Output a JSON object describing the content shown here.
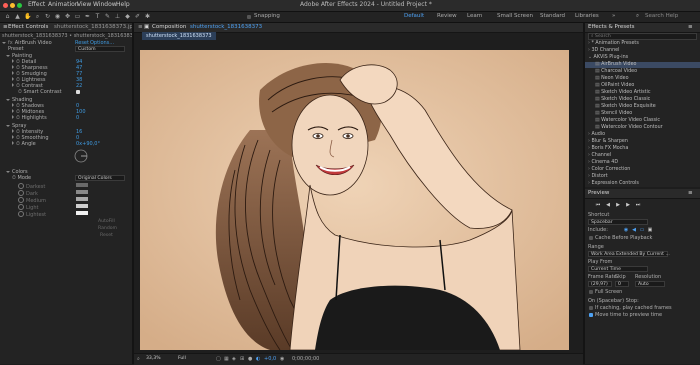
{
  "menubar": {
    "items": [
      "Effect",
      "Animation",
      "View",
      "Window",
      "Help"
    ],
    "title": "Adobe After Effects 2024 - Untitled Project *"
  },
  "toolbar": {
    "snapping_label": "Snapping",
    "workspaces": [
      "Default",
      "Review",
      "Learn",
      "Small Screen",
      "Standard",
      "Libraries"
    ],
    "search_placeholder": "Search Help"
  },
  "effect_controls": {
    "tab": "Effect Controls",
    "tab_file": "shutterstock_1831638373.jpg",
    "crumb": "shutterstock_1831638373 • shutterstock_1831638373.jpg",
    "effect_name": "AirBrush Video",
    "reset": "Reset",
    "options": "Options...",
    "preset_label": "Preset",
    "preset_value": "Custom",
    "painting_label": "Painting",
    "params_painting": [
      {
        "name": "Detail",
        "value": "94"
      },
      {
        "name": "Sharpness",
        "value": "47"
      },
      {
        "name": "Smudging",
        "value": "77"
      },
      {
        "name": "Lightness",
        "value": "38"
      },
      {
        "name": "Contrast",
        "value": "22"
      }
    ],
    "smart_contrast": "Smart Contrast",
    "shading_label": "Shading",
    "params_shading": [
      {
        "name": "Shadows",
        "value": "0"
      },
      {
        "name": "Midtones",
        "value": "100"
      },
      {
        "name": "Highlights",
        "value": "0"
      }
    ],
    "spray_label": "Spray",
    "params_spray": [
      {
        "name": "Intensity",
        "value": "16"
      },
      {
        "name": "Smoothing",
        "value": "0"
      },
      {
        "name": "Angle",
        "value": "0x+90,0°"
      }
    ],
    "colors_label": "Colors",
    "mode_label": "Mode",
    "mode_value": "Original Colors",
    "color_rows": [
      "Darkest",
      "Dark",
      "Medium",
      "Light",
      "Lightest"
    ],
    "autofill": "AutoFill",
    "random": "Random",
    "reset_btn": "Reset"
  },
  "composition": {
    "tab": "Composition",
    "comp_name": "shutterstock_1831638373",
    "sub_tab": "shutterstock_1831638373",
    "zoom": "33,3%",
    "resolution": "Full",
    "exposure": "+0,0",
    "timecode": "0;00;00;00"
  },
  "effects_presets": {
    "title": "Effects & Presets",
    "search_placeholder": "Search",
    "items": [
      {
        "label": "* Animation Presets",
        "indent": 0,
        "type": "cat"
      },
      {
        "label": "3D Channel",
        "indent": 0,
        "type": "cat"
      },
      {
        "label": "AKVIS Plug-ins",
        "indent": 0,
        "type": "open"
      },
      {
        "label": "AirBrush Video",
        "indent": 1,
        "type": "fx",
        "selected": true
      },
      {
        "label": "Charcoal Video",
        "indent": 1,
        "type": "fx"
      },
      {
        "label": "Neon Video",
        "indent": 1,
        "type": "fx"
      },
      {
        "label": "OilPaint Video",
        "indent": 1,
        "type": "fx"
      },
      {
        "label": "Sketch Video Artistic",
        "indent": 1,
        "type": "fx"
      },
      {
        "label": "Sketch Video Classic",
        "indent": 1,
        "type": "fx"
      },
      {
        "label": "Sketch Video Exquisite",
        "indent": 1,
        "type": "fx"
      },
      {
        "label": "Stencil Video",
        "indent": 1,
        "type": "fx"
      },
      {
        "label": "Watercolor Video Classic",
        "indent": 1,
        "type": "fx"
      },
      {
        "label": "Watercolor Video Contour",
        "indent": 1,
        "type": "fx"
      },
      {
        "label": "Audio",
        "indent": 0,
        "type": "cat"
      },
      {
        "label": "Blur & Sharpen",
        "indent": 0,
        "type": "cat"
      },
      {
        "label": "Boris FX Mocha",
        "indent": 0,
        "type": "cat"
      },
      {
        "label": "Channel",
        "indent": 0,
        "type": "cat"
      },
      {
        "label": "Cinema 4D",
        "indent": 0,
        "type": "cat"
      },
      {
        "label": "Color Correction",
        "indent": 0,
        "type": "cat"
      },
      {
        "label": "Distort",
        "indent": 0,
        "type": "cat"
      },
      {
        "label": "Expression Controls",
        "indent": 0,
        "type": "cat"
      }
    ]
  },
  "preview": {
    "title": "Preview",
    "shortcut_label": "Shortcut",
    "shortcut_value": "Spacebar",
    "include_label": "Include:",
    "cache_label": "Cache Before Playback",
    "range_label": "Range",
    "range_value": "Work Area Extended By Current ...",
    "play_from_label": "Play From",
    "play_from_value": "Current Time",
    "frame_rate_label": "Frame Rate",
    "skip_label": "Skip",
    "resolution_label": "Resolution",
    "frame_rate_value": "(29,97)",
    "skip_value": "0",
    "resolution_value": "Auto",
    "full_screen": "Full Screen",
    "stop_label": "On (Spacebar) Stop:",
    "if_caching": "If caching, play cached frames",
    "move_time": "Move time to preview time"
  }
}
